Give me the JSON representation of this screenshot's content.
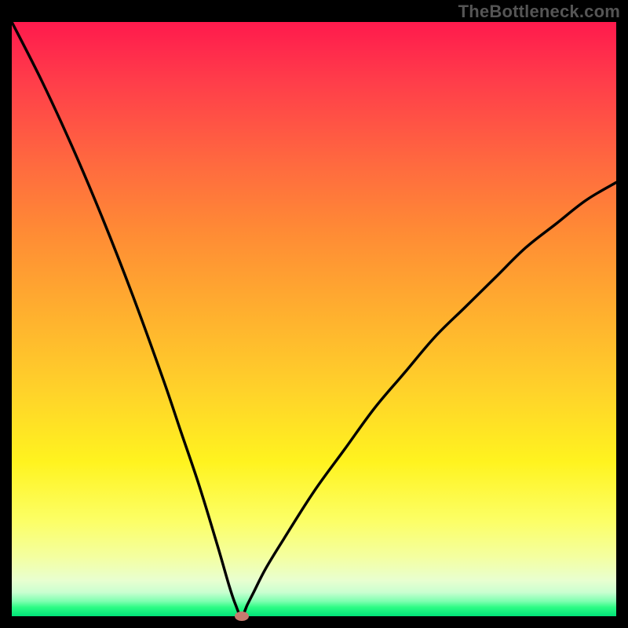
{
  "watermark": "TheBottleneck.com",
  "chart_data": {
    "type": "line",
    "title": "",
    "xlabel": "",
    "ylabel": "",
    "xlim": [
      0,
      100
    ],
    "ylim": [
      0,
      100
    ],
    "grid": false,
    "description": "V-shaped bottleneck curve over rainbow vertical gradient background. Minimum at x≈38 where y≈0. Left branch rises steeply to y=100 at x=0; right branch rises with decreasing slope to y≈73 at x=100.",
    "series": [
      {
        "name": "bottleneck-curve",
        "x": [
          0,
          5,
          10,
          15,
          20,
          25,
          28,
          31,
          34,
          36,
          37,
          38,
          39,
          40,
          42,
          45,
          50,
          55,
          60,
          65,
          70,
          75,
          80,
          85,
          90,
          95,
          100
        ],
        "y": [
          100,
          90,
          79,
          67,
          54,
          40,
          31,
          22,
          12,
          5,
          2,
          0,
          2,
          4,
          8,
          13,
          21,
          28,
          35,
          41,
          47,
          52,
          57,
          62,
          66,
          70,
          73
        ]
      }
    ],
    "marker": {
      "x": 38,
      "y": 0,
      "color": "#c67a6f"
    },
    "gradient_stops": [
      {
        "pos": 0,
        "color": "#ff1a4d"
      },
      {
        "pos": 10,
        "color": "#ff3d4a"
      },
      {
        "pos": 24,
        "color": "#ff6a3f"
      },
      {
        "pos": 35,
        "color": "#ff8a35"
      },
      {
        "pos": 48,
        "color": "#ffad2f"
      },
      {
        "pos": 62,
        "color": "#ffd22a"
      },
      {
        "pos": 74,
        "color": "#fff31f"
      },
      {
        "pos": 84,
        "color": "#fcff66"
      },
      {
        "pos": 90,
        "color": "#f4ffa0"
      },
      {
        "pos": 94,
        "color": "#e8ffd0"
      },
      {
        "pos": 96,
        "color": "#c9ffd0"
      },
      {
        "pos": 97.5,
        "color": "#7dffb0"
      },
      {
        "pos": 98.5,
        "color": "#2dfc85"
      },
      {
        "pos": 100,
        "color": "#00e378"
      }
    ]
  }
}
